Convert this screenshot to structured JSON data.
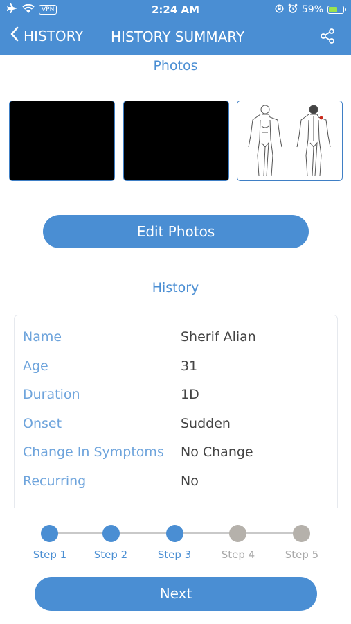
{
  "status_bar": {
    "time": "2:24 AM",
    "vpn": "VPN",
    "battery": "59%",
    "battery_level": 0.59
  },
  "nav": {
    "back_label": "HISTORY",
    "title": "HISTORY SUMMARY"
  },
  "photos": {
    "title": "Photos",
    "edit_label": "Edit Photos"
  },
  "history": {
    "title": "History",
    "rows": [
      {
        "label": "Name",
        "value": "Sherif Alian"
      },
      {
        "label": "Age",
        "value": "31"
      },
      {
        "label": "Duration",
        "value": "1D"
      },
      {
        "label": "Onset",
        "value": "Sudden"
      },
      {
        "label": "Change In Symptoms",
        "value": "No Change"
      },
      {
        "label": "Recurring",
        "value": "No"
      }
    ]
  },
  "steps": [
    {
      "label": "Step 1",
      "active": true
    },
    {
      "label": "Step 2",
      "active": true
    },
    {
      "label": "Step 3",
      "active": true
    },
    {
      "label": "Step 4",
      "active": false
    },
    {
      "label": "Step 5",
      "active": false
    }
  ],
  "next_label": "Next",
  "colors": {
    "primary": "#4a8ed3",
    "step_inactive": "#b5b1ab",
    "label_inactive": "#a9a9a9",
    "key_text": "#6ea4dc"
  }
}
